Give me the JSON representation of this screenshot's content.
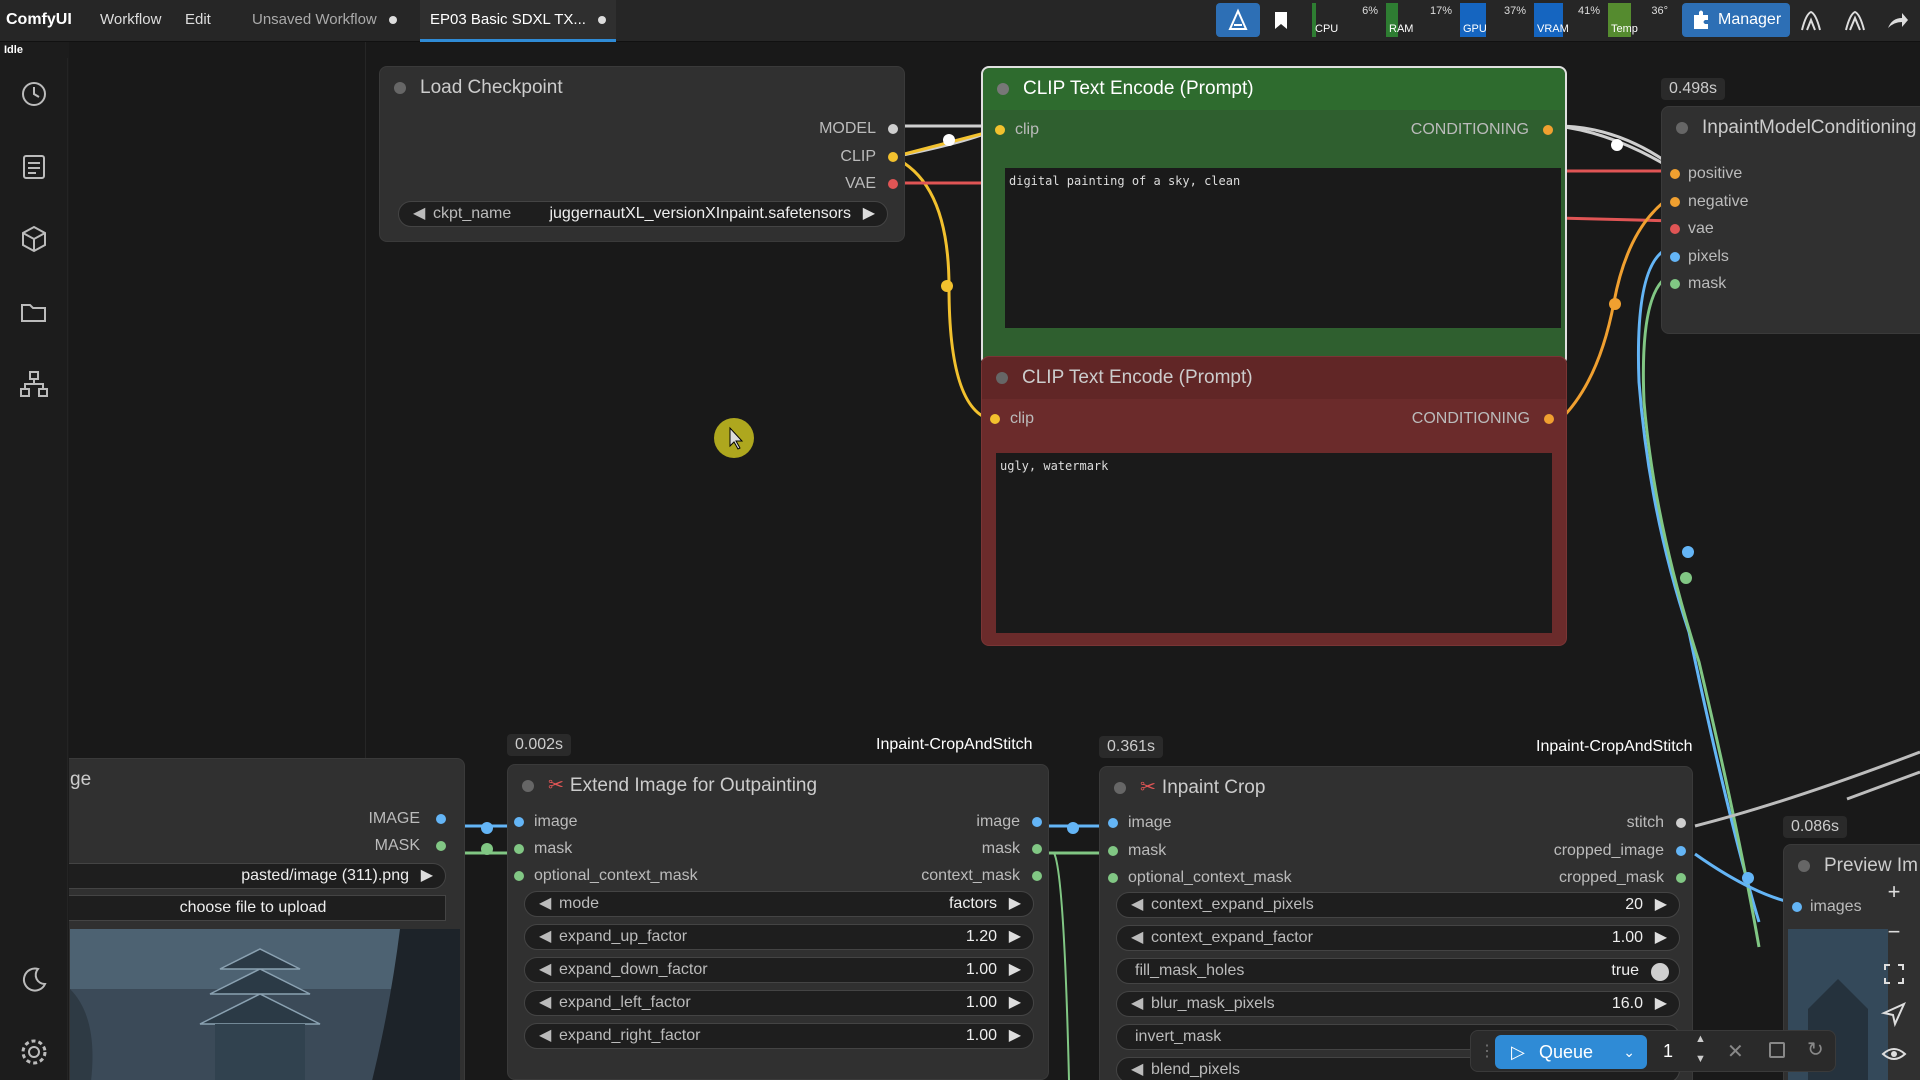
{
  "app": {
    "name": "ComfyUI",
    "menu": [
      "Workflow",
      "Edit"
    ],
    "tabs": [
      {
        "label": "Unsaved Workflow",
        "active": false
      },
      {
        "label": "EP03 Basic SDXL TX...",
        "active": true
      }
    ],
    "status": "Idle"
  },
  "resources": [
    {
      "label": "CPU",
      "value": "6%",
      "fill": 0.06,
      "color": "#2e7d32"
    },
    {
      "label": "RAM",
      "value": "17%",
      "fill": 0.17,
      "color": "#2e7d32"
    },
    {
      "label": "GPU",
      "value": "37%",
      "fill": 0.37,
      "color": "#1565c0"
    },
    {
      "label": "VRAM",
      "value": "41%",
      "fill": 0.41,
      "color": "#1565c0"
    },
    {
      "label": "Temp",
      "value": "36°",
      "fill": 0.36,
      "color": "#558b2f"
    }
  ],
  "toolbar": {
    "manager_label": "Manager"
  },
  "sidebar_icons": [
    "history-icon",
    "queue-list-icon",
    "model-library-icon",
    "workflow-folder-icon",
    "node-library-icon",
    "theme-toggle-icon",
    "settings-icon"
  ],
  "nodes": {
    "load_checkpoint": {
      "title": "Load Checkpoint",
      "outputs": [
        "MODEL",
        "CLIP",
        "VAE"
      ],
      "widget_label": "ckpt_name",
      "widget_value": "juggernautXL_versionXInpaint.safetensors"
    },
    "clip_positive": {
      "title": "CLIP Text Encode (Prompt)",
      "input": "clip",
      "output": "CONDITIONING",
      "text": "digital painting of a sky, clean"
    },
    "clip_negative": {
      "title": "CLIP Text Encode (Prompt)",
      "input": "clip",
      "output": "CONDITIONING",
      "text": "ugly, watermark"
    },
    "inpaint_model_conditioning": {
      "timing": "0.498s",
      "title": "InpaintModelConditioning",
      "inputs": [
        "positive",
        "negative",
        "vae",
        "pixels",
        "mask"
      ]
    },
    "load_image": {
      "title": "ge",
      "outputs": [
        "IMAGE",
        "MASK"
      ],
      "file": "pasted/image (311).png",
      "upload_label": "choose file to upload"
    },
    "extend_image": {
      "timing": "0.002s",
      "pack": "Inpaint-CropAndStitch",
      "title": "Extend Image for Outpainting",
      "inputs": [
        "image",
        "mask",
        "optional_context_mask"
      ],
      "outputs": [
        "image",
        "mask",
        "context_mask"
      ],
      "widgets": [
        {
          "label": "mode",
          "value": "factors"
        },
        {
          "label": "expand_up_factor",
          "value": "1.20"
        },
        {
          "label": "expand_down_factor",
          "value": "1.00"
        },
        {
          "label": "expand_left_factor",
          "value": "1.00"
        },
        {
          "label": "expand_right_factor",
          "value": "1.00"
        }
      ]
    },
    "inpaint_crop": {
      "timing": "0.361s",
      "pack": "Inpaint-CropAndStitch",
      "title": "Inpaint Crop",
      "inputs": [
        "image",
        "mask",
        "optional_context_mask"
      ],
      "outputs": [
        "stitch",
        "cropped_image",
        "cropped_mask"
      ],
      "widgets": [
        {
          "label": "context_expand_pixels",
          "value": "20"
        },
        {
          "label": "context_expand_factor",
          "value": "1.00"
        },
        {
          "label": "fill_mask_holes",
          "value": "true"
        },
        {
          "label": "blur_mask_pixels",
          "value": "16.0"
        },
        {
          "label": "invert_mask",
          "value": ""
        },
        {
          "label": "blend_pixels",
          "value": ""
        }
      ]
    },
    "preview_image": {
      "timing": "0.086s",
      "title": "Preview Im",
      "input": "images"
    }
  },
  "queue": {
    "label": "Queue",
    "count": "1"
  },
  "colors": {
    "accent": "#2f8bd6",
    "positive_node": "#2f5f2f",
    "negative_node": "#6b2b2b",
    "clip_wire": "#f2c12e",
    "vae_wire": "#e05555",
    "image_wire": "#64b5f6",
    "mask_wire": "#81c784",
    "conditioning_wire": "#f0a030"
  }
}
